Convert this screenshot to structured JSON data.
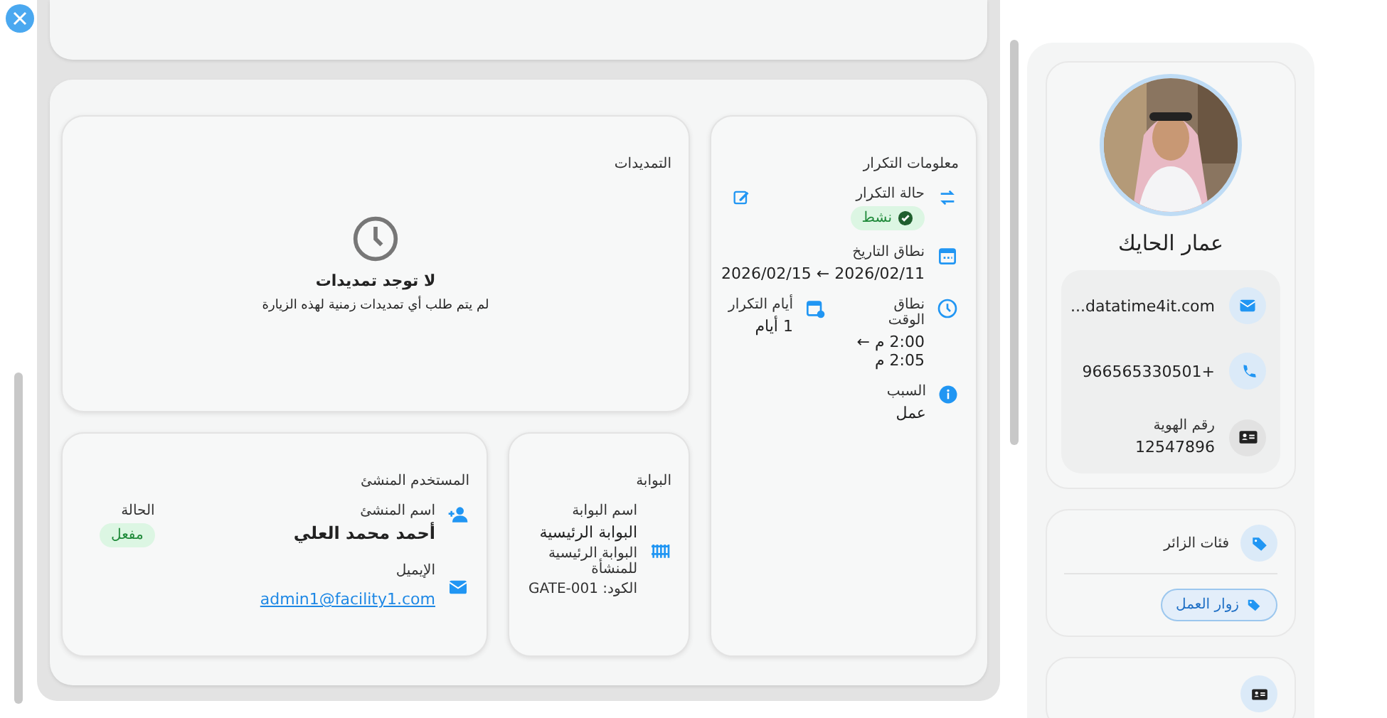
{
  "recurrence": {
    "title": "معلومات التكرار",
    "status_label": "حالة التكرار",
    "status": "نشط",
    "active": true,
    "date_label": "نطاق التاريخ",
    "date_range": "2026/02/11 ← 2026/02/15",
    "time_label": "نطاق الوقت",
    "time_range": "2:00 م ← 2:05 م",
    "days_label": "أيام التكرار",
    "days": "1 أيام",
    "reason_label": "السبب",
    "reason": "عمل"
  },
  "extensions": {
    "title": "التمديدات",
    "empty_title": "لا توجد تمديدات",
    "empty_text": "لم يتم طلب أي تمديدات زمنية لهذه الزيارة"
  },
  "creator": {
    "title": "المستخدم المنشئ",
    "name_label": "اسم المنشئ",
    "name": "أحمد محمد العلي",
    "email_label": "الإيميل",
    "email": "admin1@facility1.com",
    "status_label": "الحالة",
    "status": "مفعل",
    "active": true
  },
  "gate": {
    "title": "البوابة",
    "name_label": "اسم البوابة",
    "name": "البوابة الرئيسية",
    "description": "البوابة الرئيسية للمنشأة",
    "code": "الكود: GATE-001"
  },
  "visitor": {
    "name": "عمار الحايك",
    "email": "...datatime4it.com",
    "phone": "966565330501+",
    "id_label": "رقم الهوية",
    "id": "12547896"
  },
  "categories": {
    "title": "فئات الزائر",
    "tags": [
      "زوار العمل"
    ]
  }
}
